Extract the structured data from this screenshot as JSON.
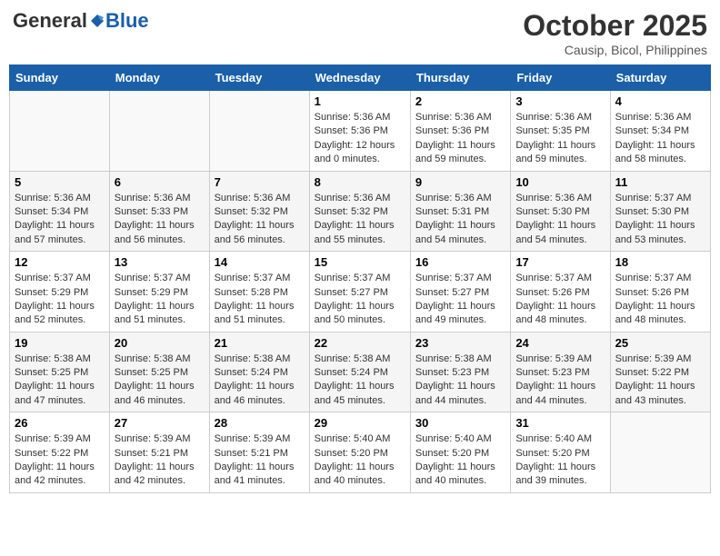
{
  "header": {
    "logo_general": "General",
    "logo_blue": "Blue",
    "month": "October 2025",
    "location": "Causip, Bicol, Philippines"
  },
  "weekdays": [
    "Sunday",
    "Monday",
    "Tuesday",
    "Wednesday",
    "Thursday",
    "Friday",
    "Saturday"
  ],
  "weeks": [
    [
      {
        "day": "",
        "sunrise": "",
        "sunset": "",
        "daylight": ""
      },
      {
        "day": "",
        "sunrise": "",
        "sunset": "",
        "daylight": ""
      },
      {
        "day": "",
        "sunrise": "",
        "sunset": "",
        "daylight": ""
      },
      {
        "day": "1",
        "sunrise": "Sunrise: 5:36 AM",
        "sunset": "Sunset: 5:36 PM",
        "daylight": "Daylight: 12 hours and 0 minutes."
      },
      {
        "day": "2",
        "sunrise": "Sunrise: 5:36 AM",
        "sunset": "Sunset: 5:36 PM",
        "daylight": "Daylight: 11 hours and 59 minutes."
      },
      {
        "day": "3",
        "sunrise": "Sunrise: 5:36 AM",
        "sunset": "Sunset: 5:35 PM",
        "daylight": "Daylight: 11 hours and 59 minutes."
      },
      {
        "day": "4",
        "sunrise": "Sunrise: 5:36 AM",
        "sunset": "Sunset: 5:34 PM",
        "daylight": "Daylight: 11 hours and 58 minutes."
      }
    ],
    [
      {
        "day": "5",
        "sunrise": "Sunrise: 5:36 AM",
        "sunset": "Sunset: 5:34 PM",
        "daylight": "Daylight: 11 hours and 57 minutes."
      },
      {
        "day": "6",
        "sunrise": "Sunrise: 5:36 AM",
        "sunset": "Sunset: 5:33 PM",
        "daylight": "Daylight: 11 hours and 56 minutes."
      },
      {
        "day": "7",
        "sunrise": "Sunrise: 5:36 AM",
        "sunset": "Sunset: 5:32 PM",
        "daylight": "Daylight: 11 hours and 56 minutes."
      },
      {
        "day": "8",
        "sunrise": "Sunrise: 5:36 AM",
        "sunset": "Sunset: 5:32 PM",
        "daylight": "Daylight: 11 hours and 55 minutes."
      },
      {
        "day": "9",
        "sunrise": "Sunrise: 5:36 AM",
        "sunset": "Sunset: 5:31 PM",
        "daylight": "Daylight: 11 hours and 54 minutes."
      },
      {
        "day": "10",
        "sunrise": "Sunrise: 5:36 AM",
        "sunset": "Sunset: 5:30 PM",
        "daylight": "Daylight: 11 hours and 54 minutes."
      },
      {
        "day": "11",
        "sunrise": "Sunrise: 5:37 AM",
        "sunset": "Sunset: 5:30 PM",
        "daylight": "Daylight: 11 hours and 53 minutes."
      }
    ],
    [
      {
        "day": "12",
        "sunrise": "Sunrise: 5:37 AM",
        "sunset": "Sunset: 5:29 PM",
        "daylight": "Daylight: 11 hours and 52 minutes."
      },
      {
        "day": "13",
        "sunrise": "Sunrise: 5:37 AM",
        "sunset": "Sunset: 5:29 PM",
        "daylight": "Daylight: 11 hours and 51 minutes."
      },
      {
        "day": "14",
        "sunrise": "Sunrise: 5:37 AM",
        "sunset": "Sunset: 5:28 PM",
        "daylight": "Daylight: 11 hours and 51 minutes."
      },
      {
        "day": "15",
        "sunrise": "Sunrise: 5:37 AM",
        "sunset": "Sunset: 5:27 PM",
        "daylight": "Daylight: 11 hours and 50 minutes."
      },
      {
        "day": "16",
        "sunrise": "Sunrise: 5:37 AM",
        "sunset": "Sunset: 5:27 PM",
        "daylight": "Daylight: 11 hours and 49 minutes."
      },
      {
        "day": "17",
        "sunrise": "Sunrise: 5:37 AM",
        "sunset": "Sunset: 5:26 PM",
        "daylight": "Daylight: 11 hours and 48 minutes."
      },
      {
        "day": "18",
        "sunrise": "Sunrise: 5:37 AM",
        "sunset": "Sunset: 5:26 PM",
        "daylight": "Daylight: 11 hours and 48 minutes."
      }
    ],
    [
      {
        "day": "19",
        "sunrise": "Sunrise: 5:38 AM",
        "sunset": "Sunset: 5:25 PM",
        "daylight": "Daylight: 11 hours and 47 minutes."
      },
      {
        "day": "20",
        "sunrise": "Sunrise: 5:38 AM",
        "sunset": "Sunset: 5:25 PM",
        "daylight": "Daylight: 11 hours and 46 minutes."
      },
      {
        "day": "21",
        "sunrise": "Sunrise: 5:38 AM",
        "sunset": "Sunset: 5:24 PM",
        "daylight": "Daylight: 11 hours and 46 minutes."
      },
      {
        "day": "22",
        "sunrise": "Sunrise: 5:38 AM",
        "sunset": "Sunset: 5:24 PM",
        "daylight": "Daylight: 11 hours and 45 minutes."
      },
      {
        "day": "23",
        "sunrise": "Sunrise: 5:38 AM",
        "sunset": "Sunset: 5:23 PM",
        "daylight": "Daylight: 11 hours and 44 minutes."
      },
      {
        "day": "24",
        "sunrise": "Sunrise: 5:39 AM",
        "sunset": "Sunset: 5:23 PM",
        "daylight": "Daylight: 11 hours and 44 minutes."
      },
      {
        "day": "25",
        "sunrise": "Sunrise: 5:39 AM",
        "sunset": "Sunset: 5:22 PM",
        "daylight": "Daylight: 11 hours and 43 minutes."
      }
    ],
    [
      {
        "day": "26",
        "sunrise": "Sunrise: 5:39 AM",
        "sunset": "Sunset: 5:22 PM",
        "daylight": "Daylight: 11 hours and 42 minutes."
      },
      {
        "day": "27",
        "sunrise": "Sunrise: 5:39 AM",
        "sunset": "Sunset: 5:21 PM",
        "daylight": "Daylight: 11 hours and 42 minutes."
      },
      {
        "day": "28",
        "sunrise": "Sunrise: 5:39 AM",
        "sunset": "Sunset: 5:21 PM",
        "daylight": "Daylight: 11 hours and 41 minutes."
      },
      {
        "day": "29",
        "sunrise": "Sunrise: 5:40 AM",
        "sunset": "Sunset: 5:20 PM",
        "daylight": "Daylight: 11 hours and 40 minutes."
      },
      {
        "day": "30",
        "sunrise": "Sunrise: 5:40 AM",
        "sunset": "Sunset: 5:20 PM",
        "daylight": "Daylight: 11 hours and 40 minutes."
      },
      {
        "day": "31",
        "sunrise": "Sunrise: 5:40 AM",
        "sunset": "Sunset: 5:20 PM",
        "daylight": "Daylight: 11 hours and 39 minutes."
      },
      {
        "day": "",
        "sunrise": "",
        "sunset": "",
        "daylight": ""
      }
    ]
  ]
}
